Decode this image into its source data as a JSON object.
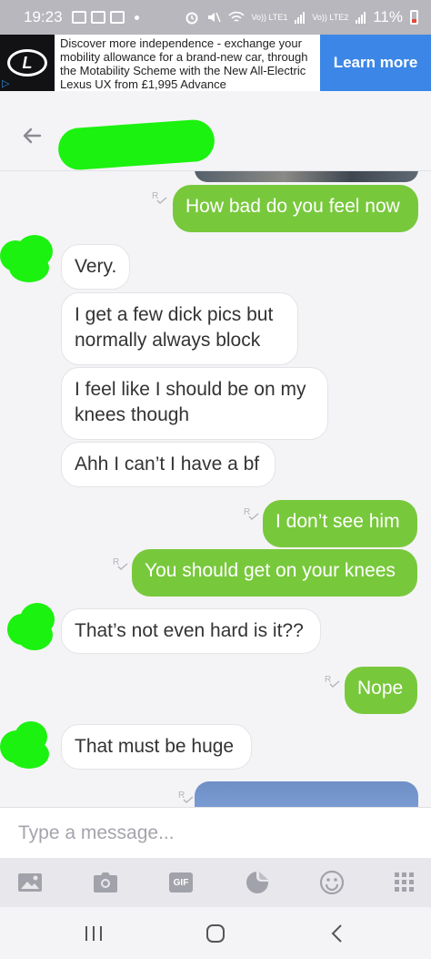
{
  "status_bar": {
    "time": "19:23",
    "sim1_label": "Vo)) LTE1",
    "sim2_label": "Vo)) LTE2",
    "battery": "11%"
  },
  "ad": {
    "logo_icon": "lexus-logo",
    "text": "Discover more independence - exchange your mobility allowance for a brand-new car, through the Motability Scheme with the New All-Electric Lexus UX from £1,995 Advance",
    "cta": "Learn more",
    "cta_color": "#3b86e6"
  },
  "header": {
    "contact_name": "",
    "back_icon": "arrow-left-icon"
  },
  "messages": [
    {
      "dir": "out",
      "text": "How bad do you feel now"
    },
    {
      "dir": "in",
      "text": "Very."
    },
    {
      "dir": "in",
      "text": "I get a few dick pics but normally always block"
    },
    {
      "dir": "in",
      "text": "I feel like I should be on my knees though"
    },
    {
      "dir": "in",
      "text": "Ahh I can’t I have a bf"
    },
    {
      "dir": "out",
      "text": "I don’t see him"
    },
    {
      "dir": "out",
      "text": "You should get on your knees"
    },
    {
      "dir": "in",
      "text": "That’s not even hard is it??"
    },
    {
      "dir": "out",
      "text": "Nope"
    },
    {
      "dir": "in",
      "text": "That must be huge"
    }
  ],
  "read_receipt_label": "R",
  "colors": {
    "outgoing": "#78c83c",
    "incoming": "#ffffff",
    "redaction": "#1bf20f"
  },
  "compose": {
    "placeholder": "Type a message..."
  },
  "toolbar": {
    "gif_label": "GIF",
    "icons": [
      "image-icon",
      "camera-icon",
      "gif-icon",
      "sticker-icon",
      "emoji-icon",
      "grid-icon"
    ]
  },
  "navbar": {
    "icons": [
      "recents-icon",
      "home-icon",
      "back-icon"
    ]
  }
}
